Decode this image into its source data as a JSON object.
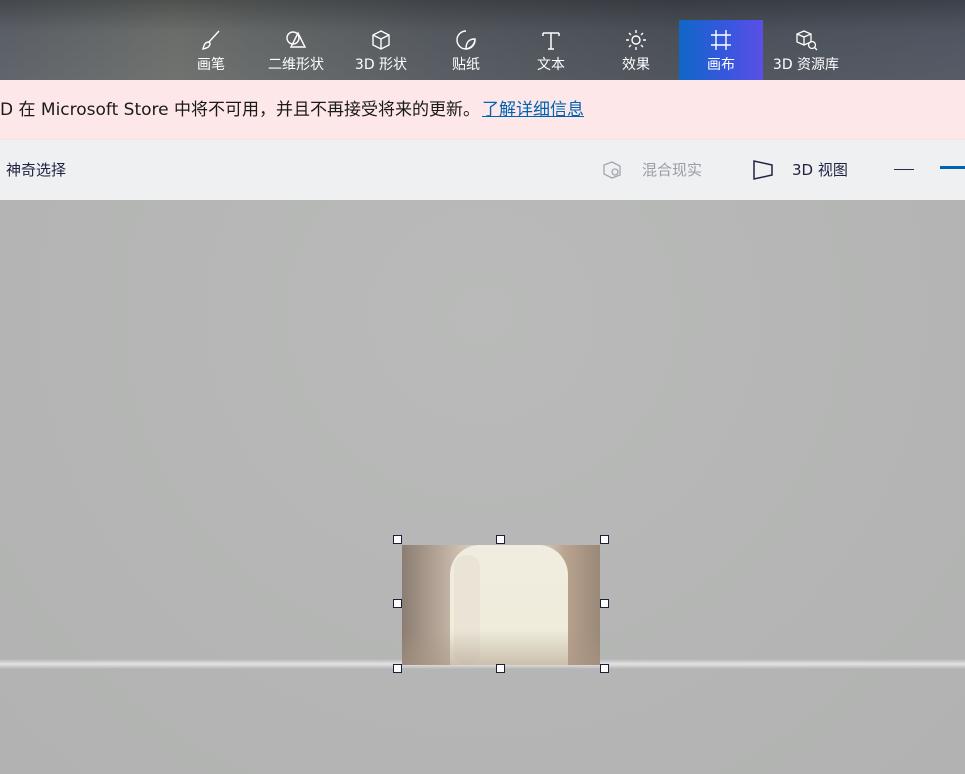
{
  "ribbon": {
    "tools": [
      {
        "label": "画笔",
        "icon": "brush-icon"
      },
      {
        "label": "二维形状",
        "icon": "2d-shapes-icon"
      },
      {
        "label": "3D 形状",
        "icon": "3d-shapes-icon"
      },
      {
        "label": "贴纸",
        "icon": "sticker-icon"
      },
      {
        "label": "文本",
        "icon": "text-icon"
      },
      {
        "label": "效果",
        "icon": "effects-icon"
      },
      {
        "label": "画布",
        "icon": "canvas-icon",
        "active": true
      },
      {
        "label": "3D 资源库",
        "icon": "3d-library-icon"
      }
    ],
    "active_color": "#3a56de"
  },
  "notice": {
    "text": "D 在 Microsoft Store 中将不可用，并且不再接受将来的更新。",
    "link": "了解详细信息",
    "background": "#fde7e9",
    "link_color": "#0063b1"
  },
  "toolbar": {
    "magic_select": "神奇选择",
    "mixed_reality": "混合现实",
    "view_3d": "3D 视图"
  }
}
